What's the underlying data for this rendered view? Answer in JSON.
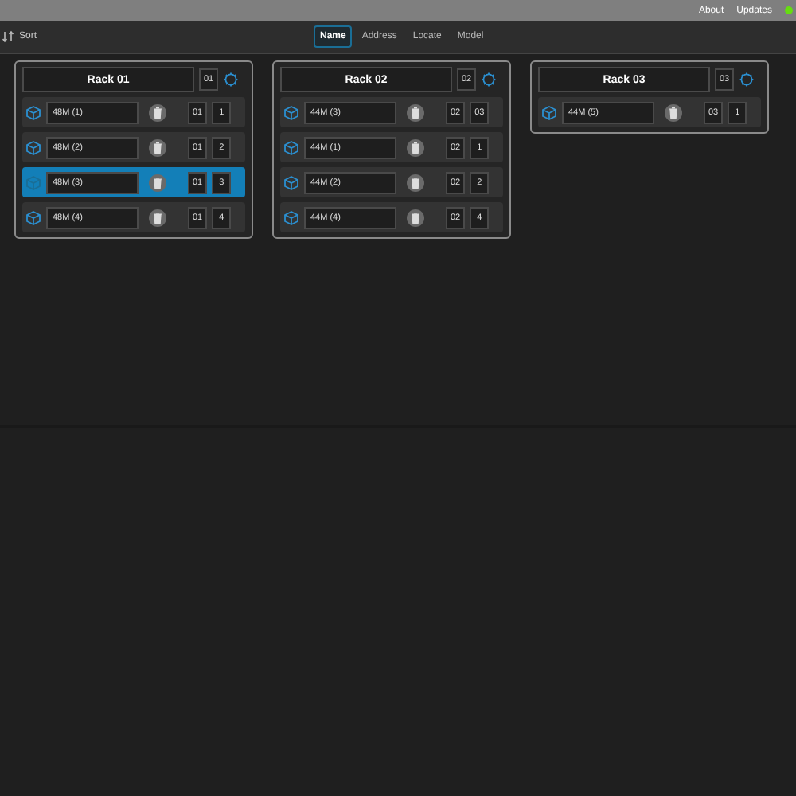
{
  "top_bar": {
    "links": [
      "About",
      "Updates"
    ],
    "status_dot": {
      "color": "#66dd11"
    }
  },
  "toolbar": {
    "sort_label": "Sort",
    "tabs": [
      {
        "label": "Name",
        "selected": true
      },
      {
        "label": "Address",
        "selected": false
      },
      {
        "label": "Locate",
        "selected": false
      },
      {
        "label": "Model",
        "selected": false
      }
    ]
  },
  "racks": [
    {
      "name": "Rack 01",
      "number": "01",
      "devices": [
        {
          "name": "48M (1)",
          "rack": "01",
          "slot": "1",
          "selected": false
        },
        {
          "name": "48M (2)",
          "rack": "01",
          "slot": "2",
          "selected": false
        },
        {
          "name": "48M (3)",
          "rack": "01",
          "slot": "3",
          "selected": true
        },
        {
          "name": "48M (4)",
          "rack": "01",
          "slot": "4",
          "selected": false
        }
      ]
    },
    {
      "name": "Rack 02",
      "number": "02",
      "devices": [
        {
          "name": "44M (3)",
          "rack": "02",
          "slot": "03",
          "selected": false
        },
        {
          "name": "44M (1)",
          "rack": "02",
          "slot": "1",
          "selected": false
        },
        {
          "name": "44M (2)",
          "rack": "02",
          "slot": "2",
          "selected": false
        },
        {
          "name": "44M (4)",
          "rack": "02",
          "slot": "4",
          "selected": false
        }
      ]
    },
    {
      "name": "Rack 03",
      "number": "03",
      "devices": [
        {
          "name": "44M (5)",
          "rack": "03",
          "slot": "1",
          "selected": false
        }
      ]
    }
  ]
}
